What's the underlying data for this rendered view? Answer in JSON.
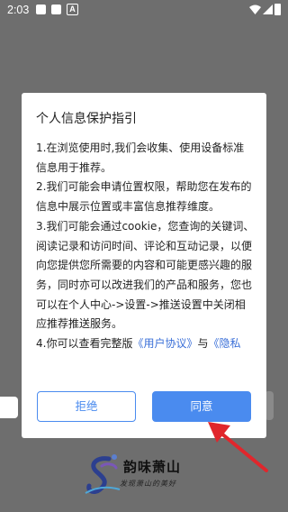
{
  "status_bar": {
    "time": "2:03",
    "a_glyph": "A",
    "icons": [
      "notification-square-icon",
      "notification-square-icon",
      "a-icon",
      "wifi-icon",
      "signal-icon",
      "battery-icon"
    ]
  },
  "dialog": {
    "title": "个人信息保护指引",
    "p1": "1.在浏览使用时,我们会收集、使用设备标准信息用于推荐。",
    "p2": "2.我们可能会申请位置权限，帮助您在发布的信息中展示位置或丰富信息推荐维度。",
    "p3": "3.我们可能会通过cookie，您查询的关键词、阅读记录和访问时间、评论和互动记录，以便向您提供您所需要的内容和可能更感兴趣的服务，同时亦可以改进我们的产品和服务，您也可以在个人中心->设置->推送设置中关闭相应推荐推送服务。",
    "p4_prefix": "4.你可以查看完整版",
    "user_agreement_link": "《用户协议》",
    "p4_and": "与",
    "privacy_link": "《隐私",
    "reject_label": "拒绝",
    "agree_label": "同意"
  },
  "branding": {
    "title": "韵味萧山",
    "subtitle": "发现萧山的美好"
  },
  "colors": {
    "accent": "#4a8bef",
    "link": "#3a6fd8",
    "annotation_arrow": "#e0262c",
    "overlay": "#6e6e6e"
  }
}
